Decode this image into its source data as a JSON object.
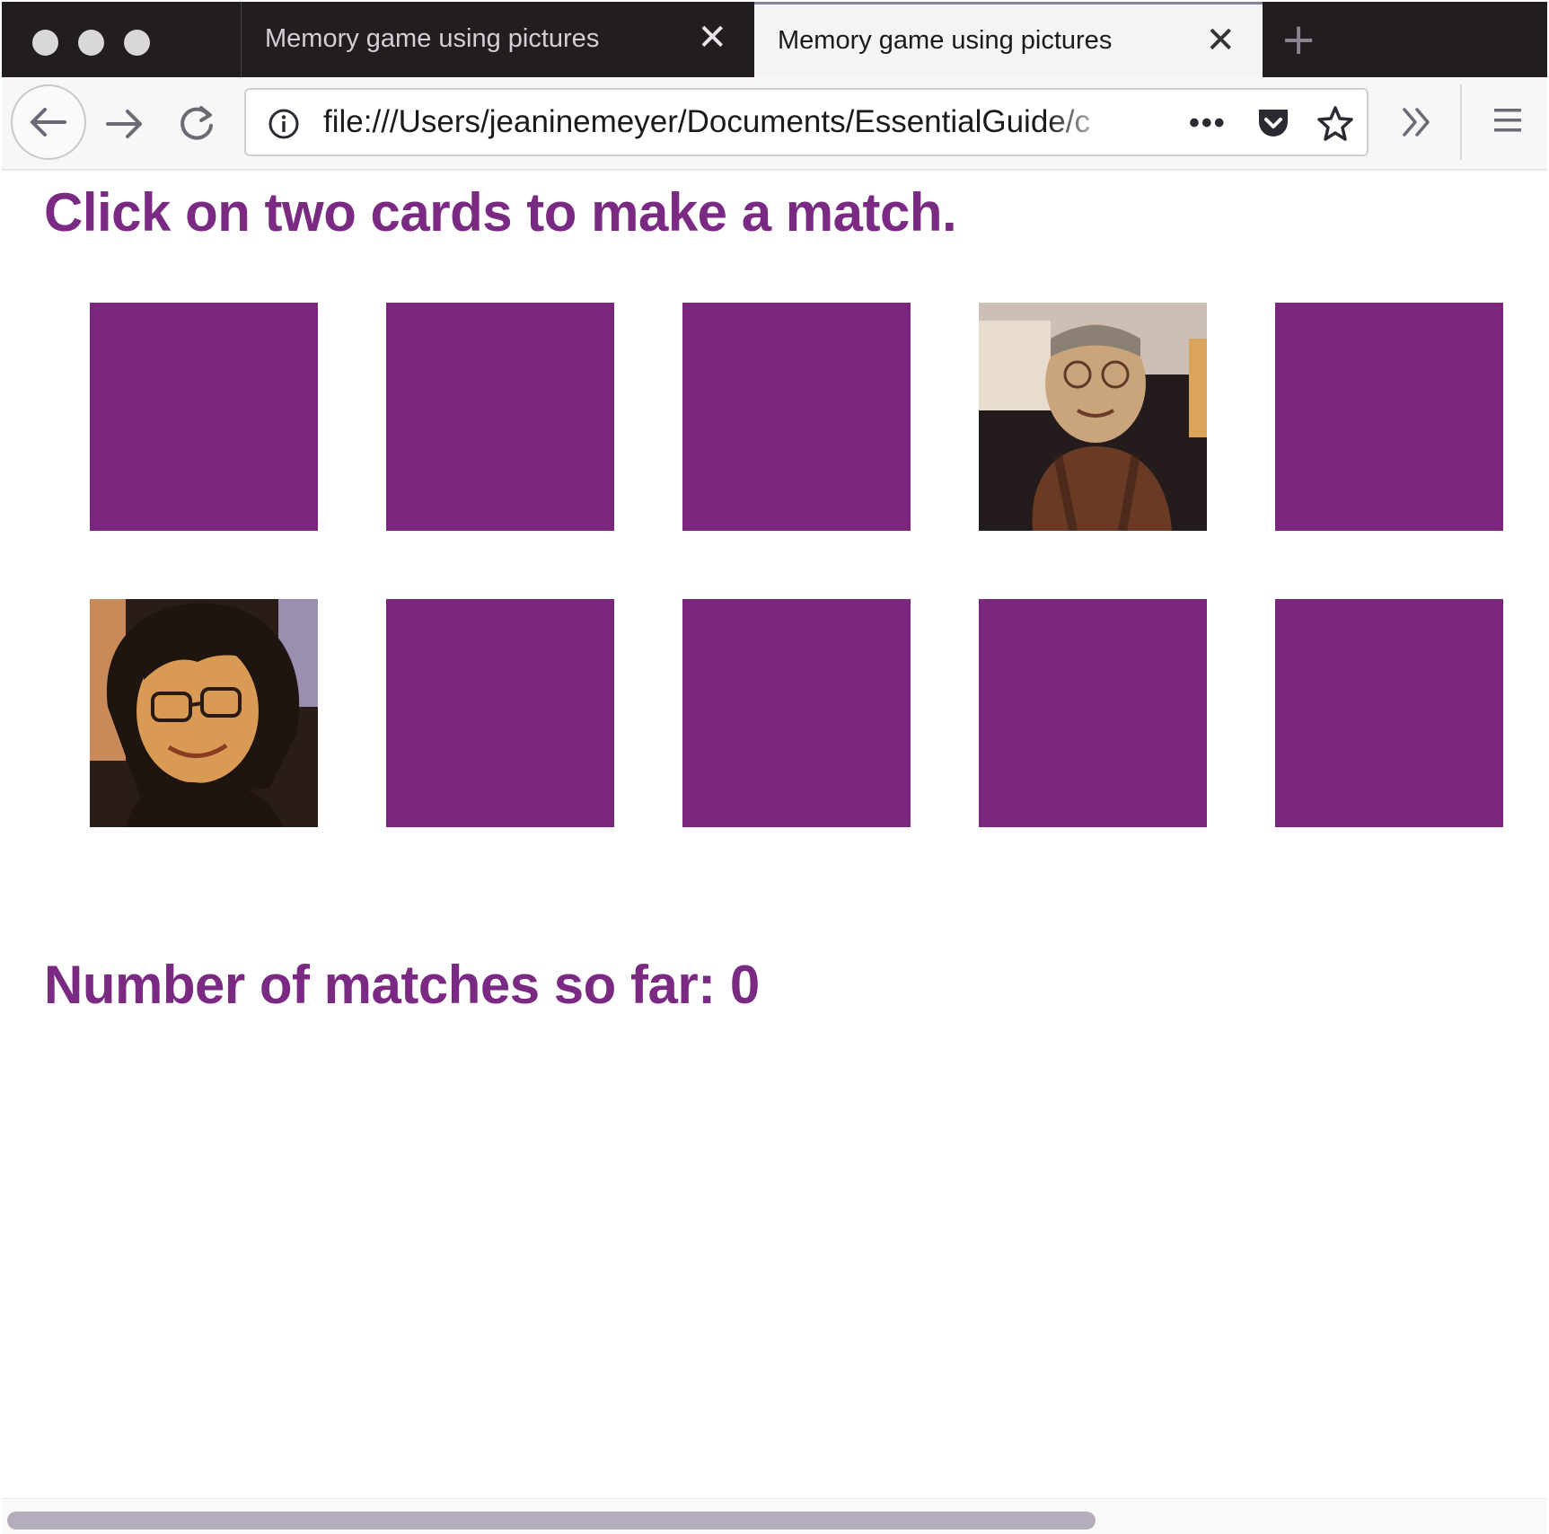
{
  "browser": {
    "tabs": [
      {
        "title": "Memory game using pictures",
        "close": "✕"
      },
      {
        "title": "Memory game using pictures",
        "close": "✕"
      }
    ],
    "new_tab": "+",
    "url": "file:///Users/jeaninemeyer/Documents/EssentialGuide/c",
    "page_actions": "•••"
  },
  "game": {
    "instruction": "Click on two cards to make a match.",
    "status": "Number of matches so far: 0",
    "card_back_color": "#7b267d",
    "cards": [
      {
        "state": "face-down"
      },
      {
        "state": "face-down"
      },
      {
        "state": "face-down"
      },
      {
        "state": "face-up",
        "picture": "elderly-woman-photo"
      },
      {
        "state": "face-down"
      },
      {
        "state": "face-up",
        "picture": "young-woman-photo"
      },
      {
        "state": "face-down"
      },
      {
        "state": "face-down"
      },
      {
        "state": "face-down"
      },
      {
        "state": "face-down"
      }
    ]
  },
  "colors": {
    "accent": "#7b2a84",
    "tab_strip": "#221d1f"
  }
}
